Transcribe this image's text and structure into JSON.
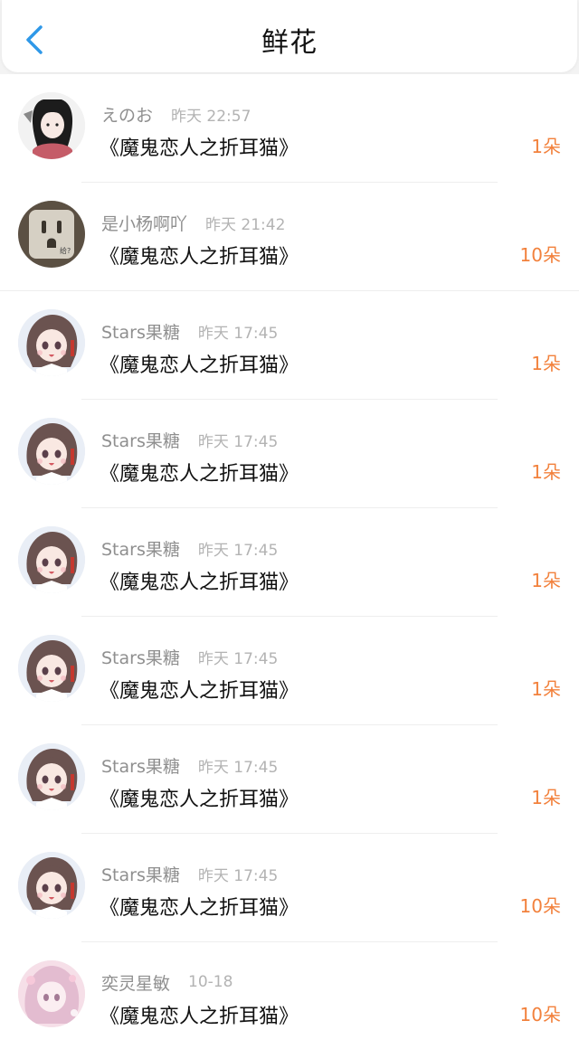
{
  "header": {
    "back_icon": "chevron-left-icon",
    "title": "鲜花",
    "accent": "#2f98e8"
  },
  "colors": {
    "name": "#8f8f8f",
    "time": "#b3b3b3",
    "count": "#f2813c"
  },
  "items": [
    {
      "name": "えのお",
      "time": "昨天 22:57",
      "book": "《魔鬼恋人之折耳猫》",
      "count": "1朵",
      "avatar": "avatar-girl-dark-hair"
    },
    {
      "name": "是小杨啊吖",
      "time": "昨天 21:42",
      "book": "《魔鬼恋人之折耳猫》",
      "count": "10朵",
      "avatar": "avatar-socket"
    },
    {
      "name": "Stars果糖",
      "time": "昨天 17:45",
      "book": "《魔鬼恋人之折耳猫》",
      "count": "1朵",
      "avatar": "avatar-anime-girl"
    },
    {
      "name": "Stars果糖",
      "time": "昨天 17:45",
      "book": "《魔鬼恋人之折耳猫》",
      "count": "1朵",
      "avatar": "avatar-anime-girl"
    },
    {
      "name": "Stars果糖",
      "time": "昨天 17:45",
      "book": "《魔鬼恋人之折耳猫》",
      "count": "1朵",
      "avatar": "avatar-anime-girl"
    },
    {
      "name": "Stars果糖",
      "time": "昨天 17:45",
      "book": "《魔鬼恋人之折耳猫》",
      "count": "1朵",
      "avatar": "avatar-anime-girl"
    },
    {
      "name": "Stars果糖",
      "time": "昨天 17:45",
      "book": "《魔鬼恋人之折耳猫》",
      "count": "1朵",
      "avatar": "avatar-anime-girl"
    },
    {
      "name": "Stars果糖",
      "time": "昨天 17:45",
      "book": "《魔鬼恋人之折耳猫》",
      "count": "10朵",
      "avatar": "avatar-anime-girl"
    },
    {
      "name": "奕灵星敏",
      "time": "10-18",
      "book": "《魔鬼恋人之折耳猫》",
      "count": "10朵",
      "avatar": "avatar-pink-anime-girl"
    }
  ]
}
